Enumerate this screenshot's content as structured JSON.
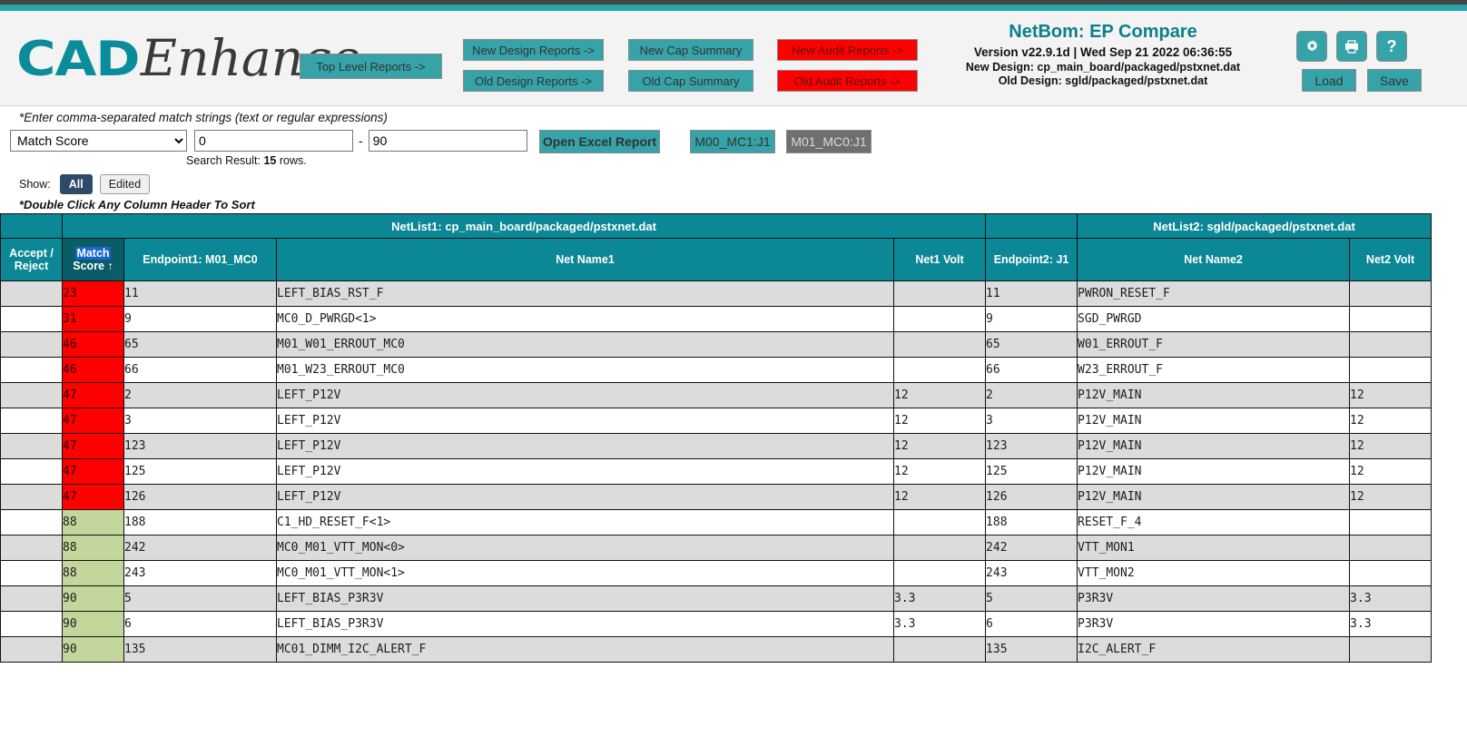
{
  "brand": {
    "part1": "CAD",
    "part2": "Enhance"
  },
  "header": {
    "top_level_button": "Top Level Reports ->",
    "design_buttons": [
      "New Design Reports ->",
      "Old Design Reports ->"
    ],
    "cap_buttons": [
      "New Cap Summary",
      "Old Cap Summary"
    ],
    "audit_buttons": [
      "New Audit Reports ->",
      "Old Audit Reports ->"
    ],
    "app_title": "NetBom: EP Compare",
    "version_line": "Version v22.9.1d | Wed Sep 21 2022 06:36:55",
    "new_design": "New Design: cp_main_board/packaged/pstxnet.dat",
    "old_design": "Old Design: sgld/packaged/pstxnet.dat",
    "icons": [
      "gear-icon",
      "printer-icon",
      "help-icon"
    ],
    "help_glyph": "?",
    "load_label": "Load",
    "save_label": "Save",
    "accent_teal": "#35a3a8",
    "accent_red": "#fe0000"
  },
  "filters": {
    "hint_top": "*Enter comma-separated match strings (text or regular expressions)",
    "field_selected": "Match Score",
    "field_options": [
      "Match Score"
    ],
    "range_min": "0",
    "range_max": "90",
    "dash": "-",
    "search_result_prefix": "Search Result: ",
    "search_result_count": "15",
    "search_result_suffix": " rows.",
    "show_label": "Show:",
    "show_all": "All",
    "show_edited": "Edited",
    "excel_button": "Open Excel Report",
    "ep_button_1": "M00_MC1:J1",
    "ep_button_2": "M01_MC0:J1",
    "hint_bottom": "*Double Click Any Column Header To Sort"
  },
  "table": {
    "group_headers": {
      "left": "NetList1: cp_main_board/packaged/pstxnet.dat",
      "right": "NetList2: sgld/packaged/pstxnet.dat"
    },
    "columns": {
      "accept_reject_l1": "Accept /",
      "accept_reject_l2": "Reject",
      "match_score_l1": "Match",
      "match_score_l2": "Score ↑",
      "endpoint1": "Endpoint1: M01_MC0",
      "net_name1": "Net Name1",
      "net1_volt": "Net1 Volt",
      "endpoint2": "Endpoint2: J1",
      "net_name2": "Net Name2",
      "net2_volt": "Net2 Volt"
    },
    "rows": [
      {
        "accept": "",
        "score": "23",
        "score_color": "red",
        "endpoint1": "11",
        "net_name1": "LEFT_BIAS_RST_F",
        "net1_volt": "",
        "endpoint2": "11",
        "net_name2": "PWRON_RESET_F",
        "net2_volt": ""
      },
      {
        "accept": "",
        "score": "31",
        "score_color": "red",
        "endpoint1": "9",
        "net_name1": "MC0_D_PWRGD<1>",
        "net1_volt": "",
        "endpoint2": "9",
        "net_name2": "SGD_PWRGD",
        "net2_volt": ""
      },
      {
        "accept": "",
        "score": "46",
        "score_color": "red",
        "endpoint1": "65",
        "net_name1": "M01_W01_ERROUT_MC0",
        "net1_volt": "",
        "endpoint2": "65",
        "net_name2": "W01_ERROUT_F",
        "net2_volt": ""
      },
      {
        "accept": "",
        "score": "46",
        "score_color": "red",
        "endpoint1": "66",
        "net_name1": "M01_W23_ERROUT_MC0",
        "net1_volt": "",
        "endpoint2": "66",
        "net_name2": "W23_ERROUT_F",
        "net2_volt": ""
      },
      {
        "accept": "",
        "score": "47",
        "score_color": "red",
        "endpoint1": "2",
        "net_name1": "LEFT_P12V",
        "net1_volt": "12",
        "endpoint2": "2",
        "net_name2": "P12V_MAIN",
        "net2_volt": "12"
      },
      {
        "accept": "",
        "score": "47",
        "score_color": "red",
        "endpoint1": "3",
        "net_name1": "LEFT_P12V",
        "net1_volt": "12",
        "endpoint2": "3",
        "net_name2": "P12V_MAIN",
        "net2_volt": "12"
      },
      {
        "accept": "",
        "score": "47",
        "score_color": "red",
        "endpoint1": "123",
        "net_name1": "LEFT_P12V",
        "net1_volt": "12",
        "endpoint2": "123",
        "net_name2": "P12V_MAIN",
        "net2_volt": "12"
      },
      {
        "accept": "",
        "score": "47",
        "score_color": "red",
        "endpoint1": "125",
        "net_name1": "LEFT_P12V",
        "net1_volt": "12",
        "endpoint2": "125",
        "net_name2": "P12V_MAIN",
        "net2_volt": "12"
      },
      {
        "accept": "",
        "score": "47",
        "score_color": "red",
        "endpoint1": "126",
        "net_name1": "LEFT_P12V",
        "net1_volt": "12",
        "endpoint2": "126",
        "net_name2": "P12V_MAIN",
        "net2_volt": "12"
      },
      {
        "accept": "",
        "score": "88",
        "score_color": "green",
        "endpoint1": "188",
        "net_name1": "C1_HD_RESET_F<1>",
        "net1_volt": "",
        "endpoint2": "188",
        "net_name2": "RESET_F_4",
        "net2_volt": ""
      },
      {
        "accept": "",
        "score": "88",
        "score_color": "green",
        "endpoint1": "242",
        "net_name1": "MC0_M01_VTT_MON<0>",
        "net1_volt": "",
        "endpoint2": "242",
        "net_name2": "VTT_MON1",
        "net2_volt": ""
      },
      {
        "accept": "",
        "score": "88",
        "score_color": "green",
        "endpoint1": "243",
        "net_name1": "MC0_M01_VTT_MON<1>",
        "net1_volt": "",
        "endpoint2": "243",
        "net_name2": "VTT_MON2",
        "net2_volt": ""
      },
      {
        "accept": "",
        "score": "90",
        "score_color": "green",
        "endpoint1": "5",
        "net_name1": "LEFT_BIAS_P3R3V",
        "net1_volt": "3.3",
        "endpoint2": "5",
        "net_name2": "P3R3V",
        "net2_volt": "3.3"
      },
      {
        "accept": "",
        "score": "90",
        "score_color": "green",
        "endpoint1": "6",
        "net_name1": "LEFT_BIAS_P3R3V",
        "net1_volt": "3.3",
        "endpoint2": "6",
        "net_name2": "P3R3V",
        "net2_volt": "3.3"
      },
      {
        "accept": "",
        "score": "90",
        "score_color": "green",
        "endpoint1": "135",
        "net_name1": "MC01_DIMM_I2C_ALERT_F",
        "net1_volt": "",
        "endpoint2": "135",
        "net_name2": "I2C_ALERT_F",
        "net2_volt": ""
      }
    ]
  }
}
